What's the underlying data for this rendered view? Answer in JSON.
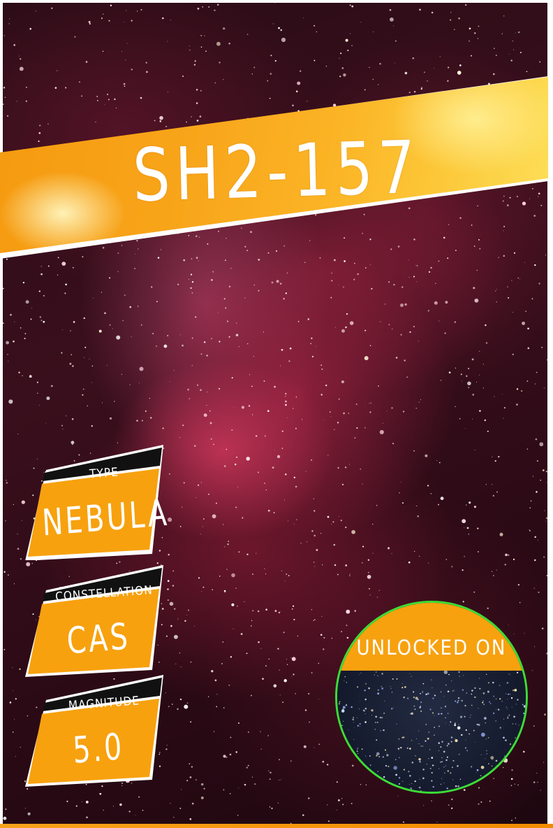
{
  "title": "SH2-157",
  "stats": [
    {
      "label": "TYPE",
      "value": "NEBULA"
    },
    {
      "label": "CONSTELLATION",
      "value": "CAS"
    },
    {
      "label": "MAGNITUDE",
      "value": "5.0"
    }
  ],
  "unlock": {
    "label": "UNLOCKED ON"
  },
  "colors": {
    "accent_orange": "#f7a10f",
    "badge_black": "#111111",
    "ring_green": "#3ddc36",
    "nebula_red": "#c8325c",
    "sky_dark": "#2a0c16"
  }
}
